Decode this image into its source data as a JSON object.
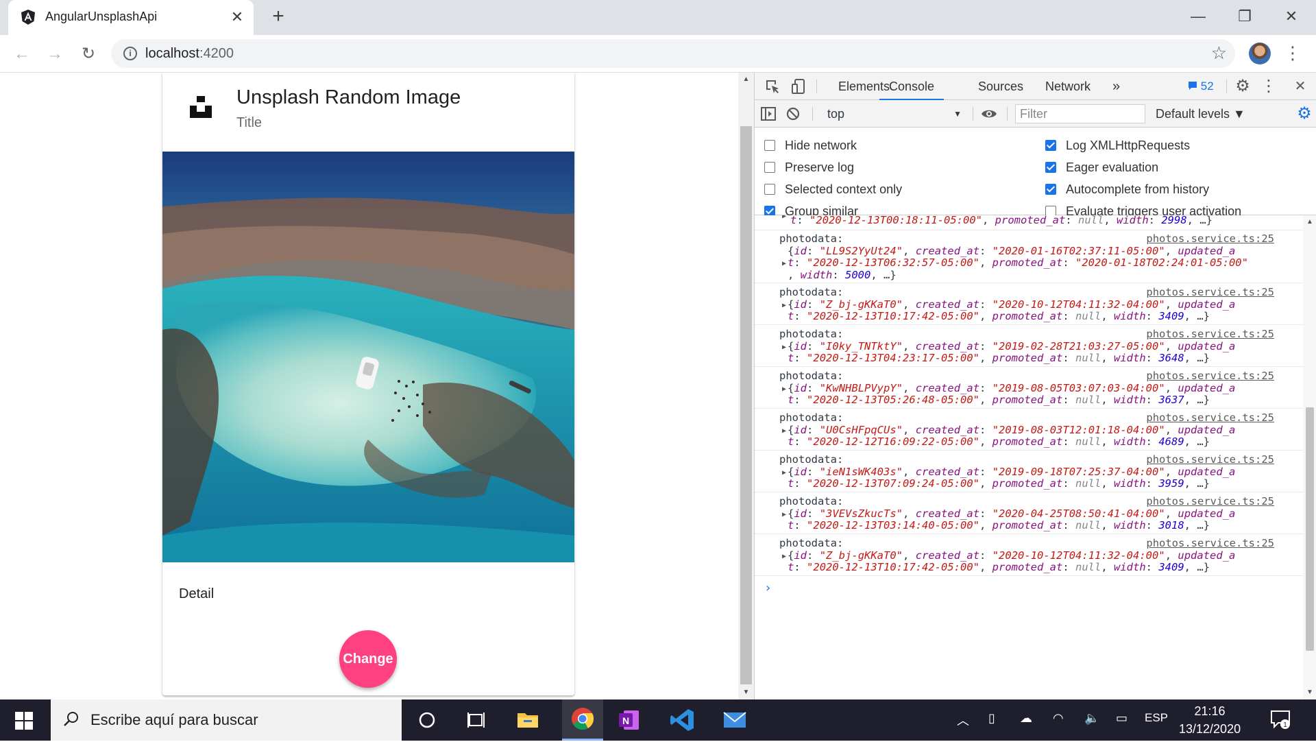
{
  "browser": {
    "tab_title": "AngularUnsplashApi",
    "tab_close": "✕",
    "new_tab": "+",
    "url_host": "localhost",
    "url_port": ":4200"
  },
  "card": {
    "title": "Unsplash Random Image",
    "subtitle": "Title",
    "detail": "Detail",
    "button": "Change"
  },
  "devtools": {
    "tabs": [
      "Elements",
      "Console",
      "Sources",
      "Network"
    ],
    "active_tab": "Console",
    "more": "»",
    "message_count": "52",
    "context": "top",
    "filter_placeholder": "Filter",
    "levels": "Default levels ▼",
    "settings": [
      {
        "label": "Hide network",
        "checked": false
      },
      {
        "label": "Log XMLHttpRequests",
        "checked": true
      },
      {
        "label": "Preserve log",
        "checked": false
      },
      {
        "label": "Eager evaluation",
        "checked": true
      },
      {
        "label": "Selected context only",
        "checked": false
      },
      {
        "label": "Autocomplete from history",
        "checked": true
      },
      {
        "label": "Group similar",
        "checked": true
      },
      {
        "label": "Evaluate triggers user activation",
        "checked": false
      }
    ],
    "partial_line": {
      "updated": "2020-12-13T00:18:11-05:00",
      "promoted": "null",
      "width": "2998"
    },
    "entries": [
      {
        "label": "photodata:",
        "source": "photos.service.ts:25",
        "id": "LL9S2YyUt24",
        "created": "2020-01-16T02:37:11-05:00",
        "updated": "2020-12-13T06:32:57-05:00",
        "promoted": "2020-01-18T02:24:01-05:00",
        "width": "5000"
      },
      {
        "label": "photodata:",
        "source": "photos.service.ts:25",
        "id": "Z_bj-gKKaT0",
        "created": "2020-10-12T04:11:32-04:00",
        "updated": "2020-12-13T10:17:42-05:00",
        "promoted": "null",
        "width": "3409"
      },
      {
        "label": "photodata:",
        "source": "photos.service.ts:25",
        "id": "I0ky_TNTktY",
        "created": "2019-02-28T21:03:27-05:00",
        "updated": "2020-12-13T04:23:17-05:00",
        "promoted": "null",
        "width": "3648"
      },
      {
        "label": "photodata:",
        "source": "photos.service.ts:25",
        "id": "KwNHBLPVypY",
        "created": "2019-08-05T03:07:03-04:00",
        "updated": "2020-12-13T05:26:48-05:00",
        "promoted": "null",
        "width": "3637"
      },
      {
        "label": "photodata:",
        "source": "photos.service.ts:25",
        "id": "U0CsHFpqCUs",
        "created": "2019-08-03T12:01:18-04:00",
        "updated": "2020-12-12T16:09:22-05:00",
        "promoted": "null",
        "width": "4689"
      },
      {
        "label": "photodata:",
        "source": "photos.service.ts:25",
        "id": "ieN1sWK403s",
        "created": "2019-09-18T07:25:37-04:00",
        "updated": "2020-12-13T07:09:24-05:00",
        "promoted": "null",
        "width": "3959"
      },
      {
        "label": "photodata:",
        "source": "photos.service.ts:25",
        "id": "3VEVsZkucTs",
        "created": "2020-04-25T08:50:41-04:00",
        "updated": "2020-12-13T03:14:40-05:00",
        "promoted": "null",
        "width": "3018"
      },
      {
        "label": "photodata:",
        "source": "photos.service.ts:25",
        "id": "Z_bj-gKKaT0",
        "created": "2020-10-12T04:11:32-04:00",
        "updated": "2020-12-13T10:17:42-05:00",
        "promoted": "null",
        "width": "3409"
      }
    ],
    "prompt": "›"
  },
  "taskbar": {
    "search_placeholder": "Escribe aquí para buscar",
    "language": "ESP",
    "time": "21:16",
    "date": "13/12/2020",
    "notifications": "1"
  },
  "colors": {
    "accent": "#1a73e8",
    "fab": "#ff4081",
    "string": "#c41a16",
    "key": "#881280",
    "number": "#1c00cf"
  }
}
